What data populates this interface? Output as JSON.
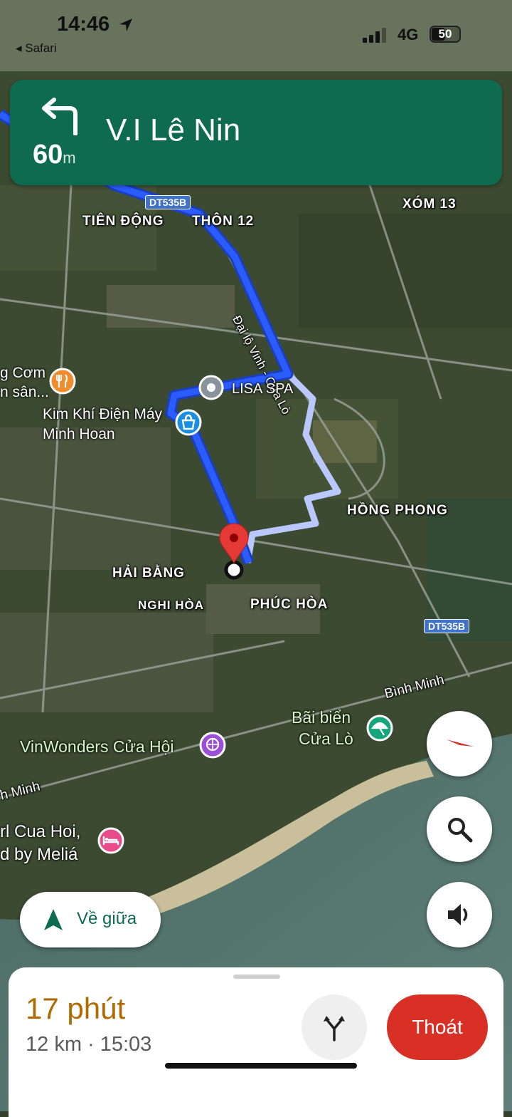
{
  "status_bar": {
    "time": "14:46",
    "back_app": "◂ Safari",
    "network": "4G",
    "battery": "50",
    "battery_level": 0.5
  },
  "navigation": {
    "distance_value": "60",
    "distance_unit": "m",
    "street": "V.I Lê Nin",
    "maneuver": "turn-left-icon"
  },
  "map_labels": {
    "road_shield_1": "DT535B",
    "road_shield_2": "DT535B",
    "tien_dong": "TIÊN ĐỘNG",
    "thon_12": "THÔN 12",
    "xom_13": "XÓM 13",
    "dai_lo": "Đại lộ Vinh - Cửa Lò",
    "hong_phong": "HỒNG PHONG",
    "hai_bang": "HẢI BẰNG",
    "nghi_hoa": "NGHI HÒA",
    "phuc_hoa": "PHÚC HÒA",
    "binh_minh": "Bình Minh",
    "binh_minh_left": "h Minh"
  },
  "pois": {
    "restaurant_line1": "g Cơm",
    "restaurant_line2": "n sân...",
    "kimkhi_line1": "Kim Khí Điện Máy",
    "kimkhi_line2": "Minh Hoan",
    "lisa": "LISA SPA",
    "vinwonders": "VinWonders Cửa Hội",
    "beach_line1": "Bãi biển",
    "beach_line2": "Cửa Lò",
    "hotel_line1": "rl Cua Hoi,",
    "hotel_line2": "d by Meliá"
  },
  "controls": {
    "recenter_label": "Về giữa",
    "exit_label": "Thoát"
  },
  "trip": {
    "duration": "17 phút",
    "detail": "12 km · 15:03"
  },
  "colors": {
    "banner": "#0e6b4f",
    "route": "#2a5cff",
    "alt_route": "#b9c8ff",
    "exit": "#d93025",
    "eta": "#b06b00"
  }
}
